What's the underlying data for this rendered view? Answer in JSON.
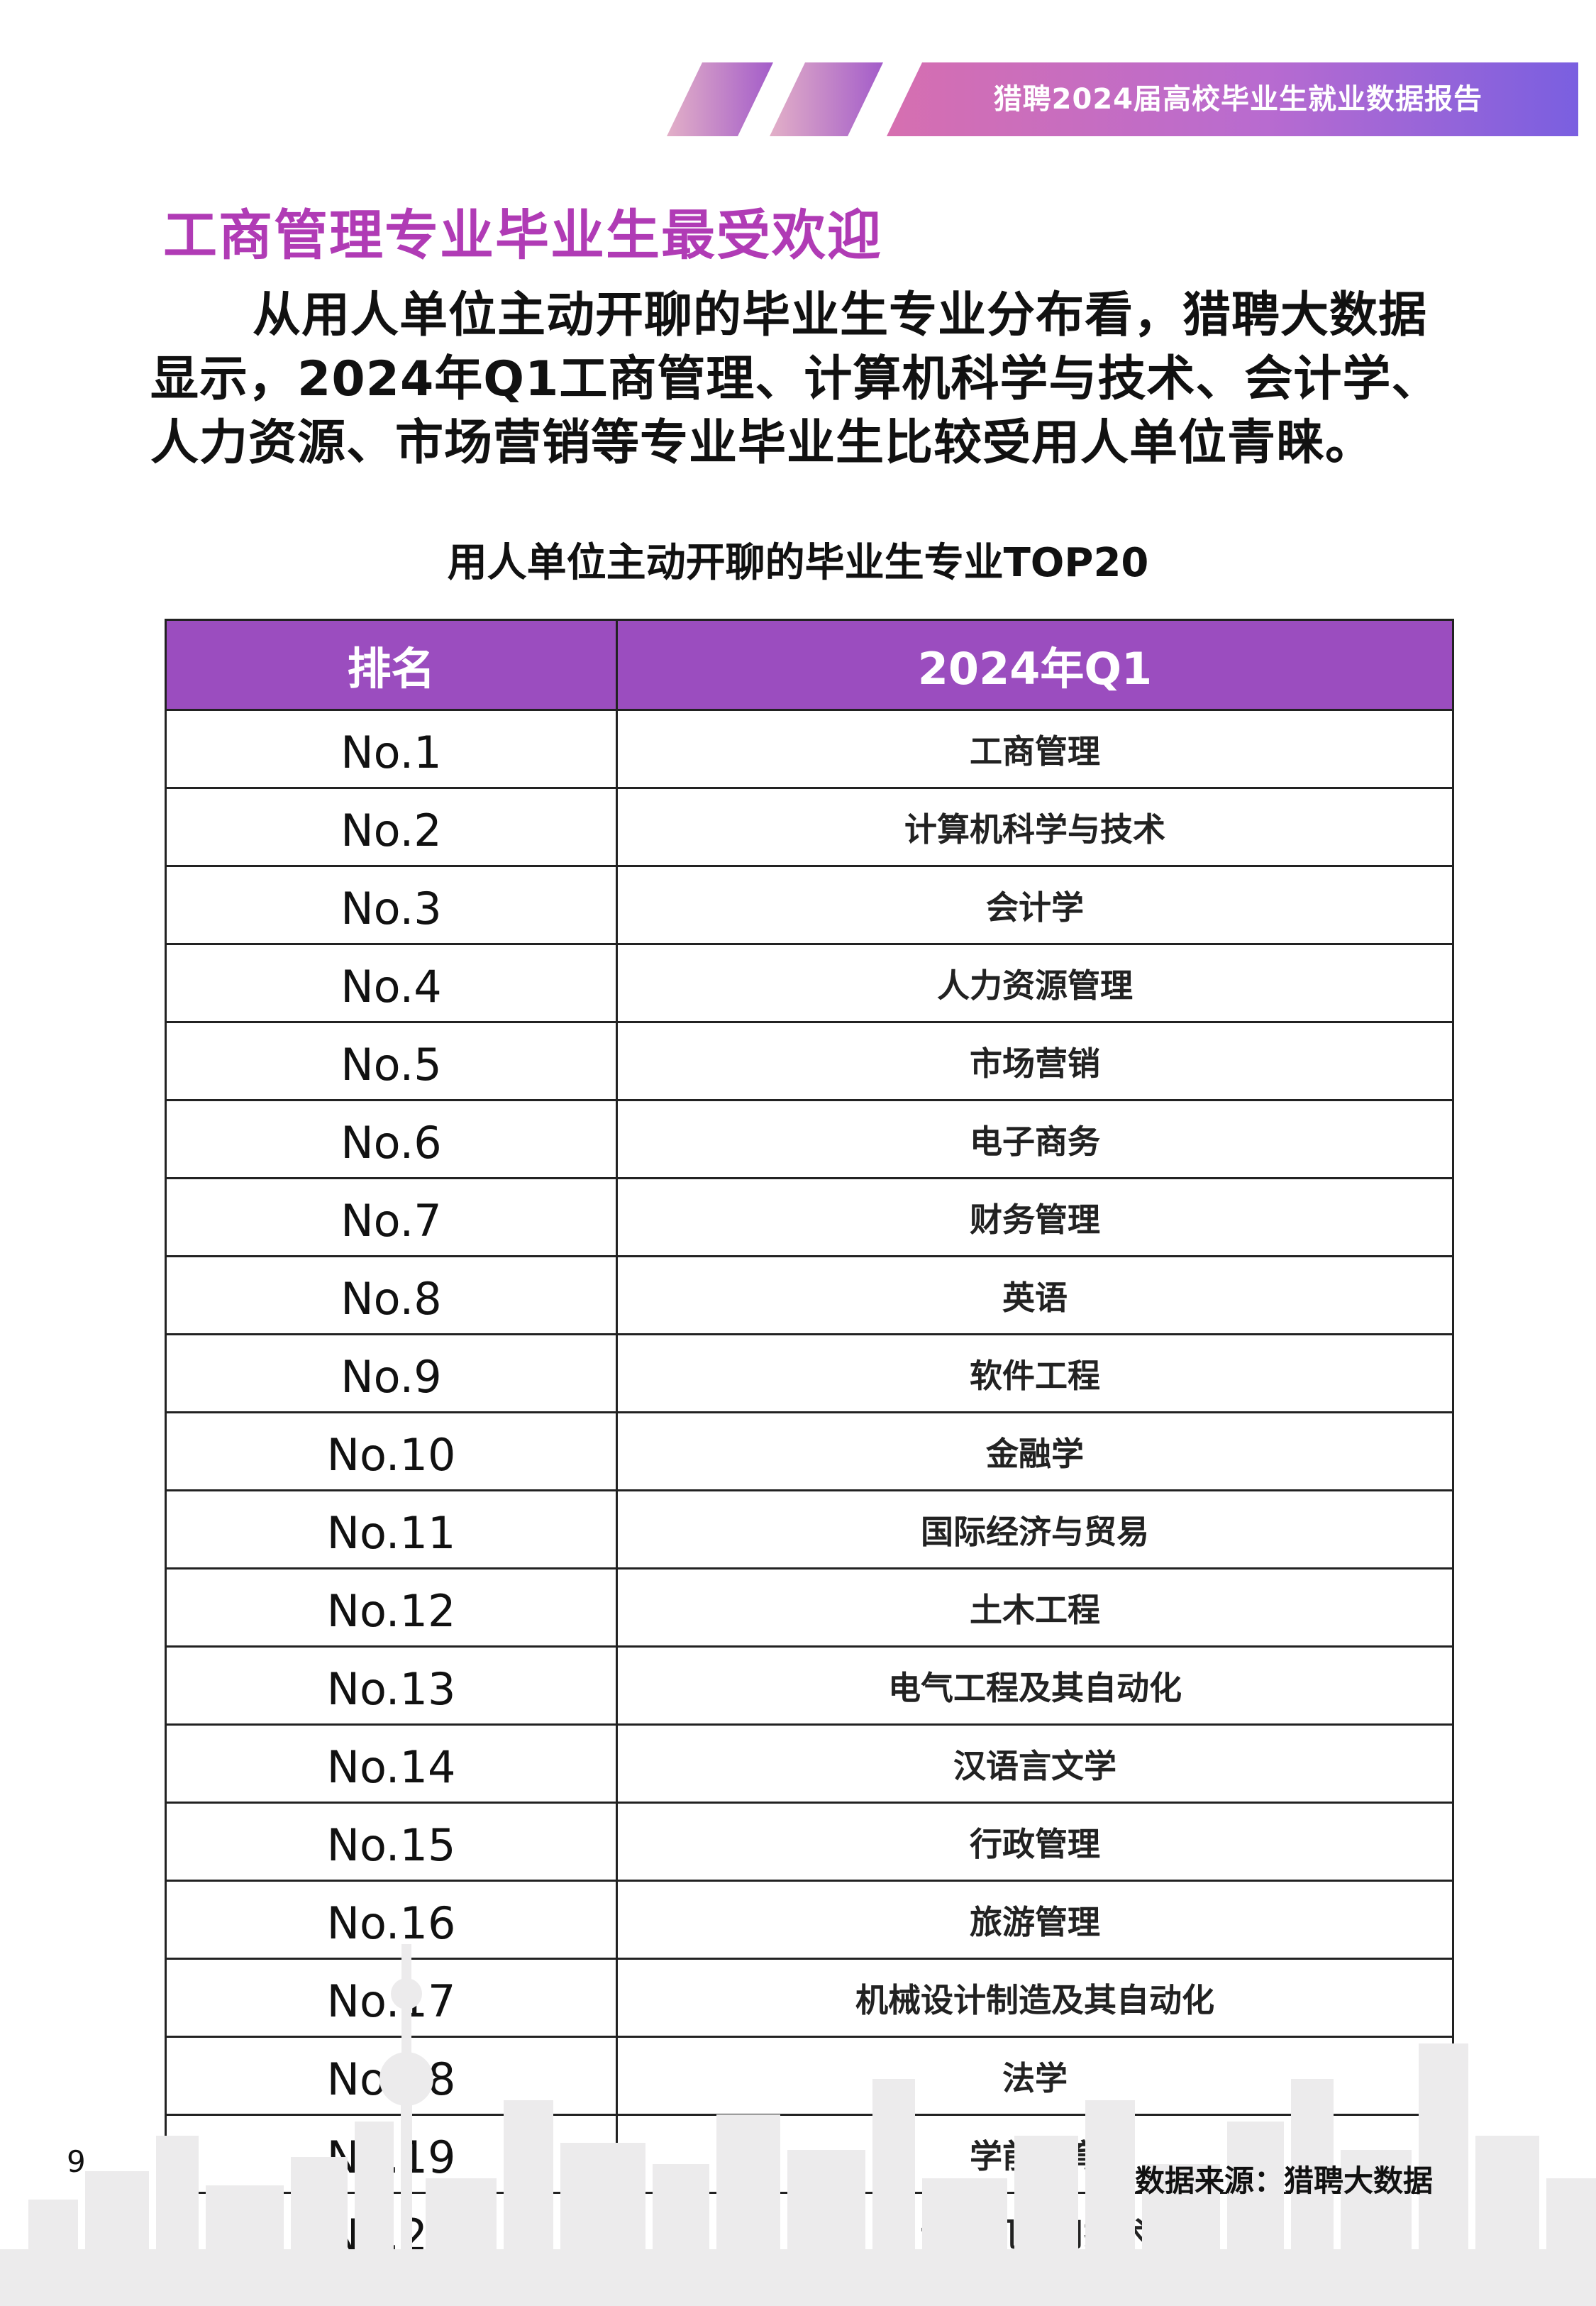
{
  "header": {
    "report_title": "猎聘2024届高校毕业生就业数据报告"
  },
  "section": {
    "title": "工商管理专业毕业生最受欢迎",
    "intro": "从用人单位主动开聊的毕业生专业分布看，猎聘大数据显示，2024年Q1工商管理、计算机科学与技术、会计学、人力资源、市场营销等专业毕业生比较受用人单位青睐。"
  },
  "table": {
    "title": "用人单位主动开聊的毕业生专业TOP20",
    "headers": [
      "排名",
      "2024年Q1"
    ],
    "rows": [
      {
        "rank": "No.1",
        "major": "工商管理"
      },
      {
        "rank": "No.2",
        "major": "计算机科学与技术"
      },
      {
        "rank": "No.3",
        "major": "会计学"
      },
      {
        "rank": "No.4",
        "major": "人力资源管理"
      },
      {
        "rank": "No.5",
        "major": "市场营销"
      },
      {
        "rank": "No.6",
        "major": "电子商务"
      },
      {
        "rank": "No.7",
        "major": "财务管理"
      },
      {
        "rank": "No.8",
        "major": "英语"
      },
      {
        "rank": "No.9",
        "major": "软件工程"
      },
      {
        "rank": "No.10",
        "major": "金融学"
      },
      {
        "rank": "No.11",
        "major": "国际经济与贸易"
      },
      {
        "rank": "No.12",
        "major": "土木工程"
      },
      {
        "rank": "No.13",
        "major": "电气工程及其自动化"
      },
      {
        "rank": "No.14",
        "major": "汉语言文学"
      },
      {
        "rank": "No.15",
        "major": "行政管理"
      },
      {
        "rank": "No.16",
        "major": "旅游管理"
      },
      {
        "rank": "No.17",
        "major": "机械设计制造及其自动化"
      },
      {
        "rank": "No.18",
        "major": "法学"
      },
      {
        "rank": "No.19",
        "major": "学前教育"
      },
      {
        "rank": "No.20",
        "major": "计算机应用技术"
      }
    ]
  },
  "footer": {
    "page_number": "9",
    "source": "数据来源：猎聘大数据"
  },
  "colors": {
    "accent": "#b03bb5",
    "header_fill": "#9b4dbf",
    "banner_start": "#d66fb0",
    "banner_end": "#7a5fe0"
  }
}
